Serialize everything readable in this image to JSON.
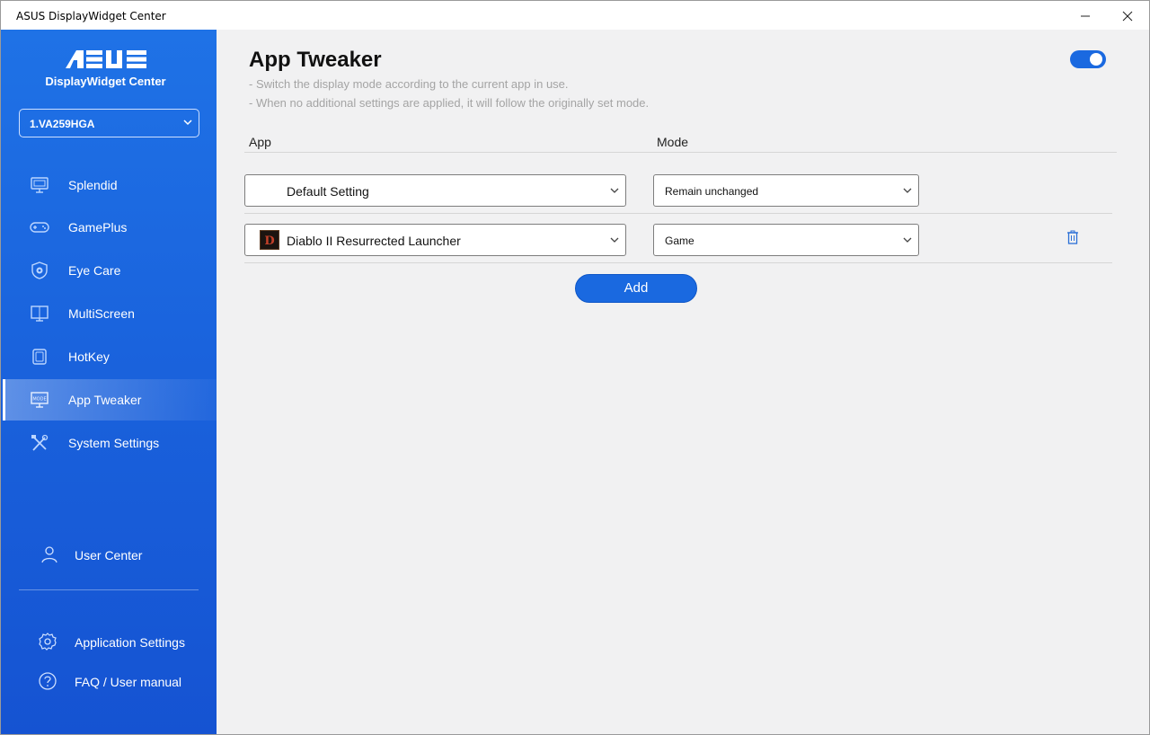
{
  "window": {
    "title": "ASUS DisplayWidget Center"
  },
  "sidebar": {
    "brand_subtitle": "DisplayWidget Center",
    "monitor": "1.VA259HGA",
    "items": [
      {
        "label": "Splendid",
        "icon": "monitor-icon"
      },
      {
        "label": "GamePlus",
        "icon": "gamepad-icon"
      },
      {
        "label": "Eye Care",
        "icon": "eye-shield-icon"
      },
      {
        "label": "MultiScreen",
        "icon": "multiscreen-icon"
      },
      {
        "label": "HotKey",
        "icon": "hotkey-icon"
      },
      {
        "label": "App Tweaker",
        "icon": "mode-monitor-icon",
        "active": true
      },
      {
        "label": "System Settings",
        "icon": "tools-icon"
      }
    ],
    "user_center": "User Center",
    "app_settings": "Application Settings",
    "faq": "FAQ / User manual"
  },
  "main": {
    "title": "App Tweaker",
    "desc1": "- Switch the display mode according to the current app in use.",
    "desc2": "- When no additional settings are applied, it will follow the originally set mode.",
    "toggle_on": true,
    "col_app": "App",
    "col_mode": "Mode",
    "rows": [
      {
        "app": "Default Setting",
        "mode": "Remain unchanged"
      },
      {
        "app": "Diablo II Resurrected Launcher",
        "mode": "Game"
      }
    ],
    "add_label": "Add"
  },
  "colors": {
    "accent": "#1a69e0",
    "sidebar": "#1a63dd",
    "background": "#f1f1f2"
  }
}
